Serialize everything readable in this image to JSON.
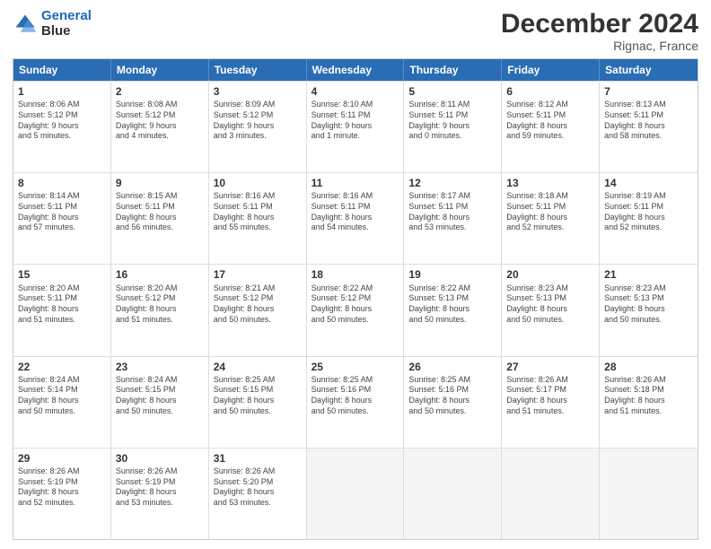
{
  "header": {
    "logo_line1": "General",
    "logo_line2": "Blue",
    "month_title": "December 2024",
    "location": "Rignac, France"
  },
  "days_of_week": [
    "Sunday",
    "Monday",
    "Tuesday",
    "Wednesday",
    "Thursday",
    "Friday",
    "Saturday"
  ],
  "weeks": [
    [
      {
        "day": "1",
        "lines": [
          "Sunrise: 8:06 AM",
          "Sunset: 5:12 PM",
          "Daylight: 9 hours",
          "and 5 minutes."
        ]
      },
      {
        "day": "2",
        "lines": [
          "Sunrise: 8:08 AM",
          "Sunset: 5:12 PM",
          "Daylight: 9 hours",
          "and 4 minutes."
        ]
      },
      {
        "day": "3",
        "lines": [
          "Sunrise: 8:09 AM",
          "Sunset: 5:12 PM",
          "Daylight: 9 hours",
          "and 3 minutes."
        ]
      },
      {
        "day": "4",
        "lines": [
          "Sunrise: 8:10 AM",
          "Sunset: 5:11 PM",
          "Daylight: 9 hours",
          "and 1 minute."
        ]
      },
      {
        "day": "5",
        "lines": [
          "Sunrise: 8:11 AM",
          "Sunset: 5:11 PM",
          "Daylight: 9 hours",
          "and 0 minutes."
        ]
      },
      {
        "day": "6",
        "lines": [
          "Sunrise: 8:12 AM",
          "Sunset: 5:11 PM",
          "Daylight: 8 hours",
          "and 59 minutes."
        ]
      },
      {
        "day": "7",
        "lines": [
          "Sunrise: 8:13 AM",
          "Sunset: 5:11 PM",
          "Daylight: 8 hours",
          "and 58 minutes."
        ]
      }
    ],
    [
      {
        "day": "8",
        "lines": [
          "Sunrise: 8:14 AM",
          "Sunset: 5:11 PM",
          "Daylight: 8 hours",
          "and 57 minutes."
        ]
      },
      {
        "day": "9",
        "lines": [
          "Sunrise: 8:15 AM",
          "Sunset: 5:11 PM",
          "Daylight: 8 hours",
          "and 56 minutes."
        ]
      },
      {
        "day": "10",
        "lines": [
          "Sunrise: 8:16 AM",
          "Sunset: 5:11 PM",
          "Daylight: 8 hours",
          "and 55 minutes."
        ]
      },
      {
        "day": "11",
        "lines": [
          "Sunrise: 8:16 AM",
          "Sunset: 5:11 PM",
          "Daylight: 8 hours",
          "and 54 minutes."
        ]
      },
      {
        "day": "12",
        "lines": [
          "Sunrise: 8:17 AM",
          "Sunset: 5:11 PM",
          "Daylight: 8 hours",
          "and 53 minutes."
        ]
      },
      {
        "day": "13",
        "lines": [
          "Sunrise: 8:18 AM",
          "Sunset: 5:11 PM",
          "Daylight: 8 hours",
          "and 52 minutes."
        ]
      },
      {
        "day": "14",
        "lines": [
          "Sunrise: 8:19 AM",
          "Sunset: 5:11 PM",
          "Daylight: 8 hours",
          "and 52 minutes."
        ]
      }
    ],
    [
      {
        "day": "15",
        "lines": [
          "Sunrise: 8:20 AM",
          "Sunset: 5:11 PM",
          "Daylight: 8 hours",
          "and 51 minutes."
        ]
      },
      {
        "day": "16",
        "lines": [
          "Sunrise: 8:20 AM",
          "Sunset: 5:12 PM",
          "Daylight: 8 hours",
          "and 51 minutes."
        ]
      },
      {
        "day": "17",
        "lines": [
          "Sunrise: 8:21 AM",
          "Sunset: 5:12 PM",
          "Daylight: 8 hours",
          "and 50 minutes."
        ]
      },
      {
        "day": "18",
        "lines": [
          "Sunrise: 8:22 AM",
          "Sunset: 5:12 PM",
          "Daylight: 8 hours",
          "and 50 minutes."
        ]
      },
      {
        "day": "19",
        "lines": [
          "Sunrise: 8:22 AM",
          "Sunset: 5:13 PM",
          "Daylight: 8 hours",
          "and 50 minutes."
        ]
      },
      {
        "day": "20",
        "lines": [
          "Sunrise: 8:23 AM",
          "Sunset: 5:13 PM",
          "Daylight: 8 hours",
          "and 50 minutes."
        ]
      },
      {
        "day": "21",
        "lines": [
          "Sunrise: 8:23 AM",
          "Sunset: 5:13 PM",
          "Daylight: 8 hours",
          "and 50 minutes."
        ]
      }
    ],
    [
      {
        "day": "22",
        "lines": [
          "Sunrise: 8:24 AM",
          "Sunset: 5:14 PM",
          "Daylight: 8 hours",
          "and 50 minutes."
        ]
      },
      {
        "day": "23",
        "lines": [
          "Sunrise: 8:24 AM",
          "Sunset: 5:15 PM",
          "Daylight: 8 hours",
          "and 50 minutes."
        ]
      },
      {
        "day": "24",
        "lines": [
          "Sunrise: 8:25 AM",
          "Sunset: 5:15 PM",
          "Daylight: 8 hours",
          "and 50 minutes."
        ]
      },
      {
        "day": "25",
        "lines": [
          "Sunrise: 8:25 AM",
          "Sunset: 5:16 PM",
          "Daylight: 8 hours",
          "and 50 minutes."
        ]
      },
      {
        "day": "26",
        "lines": [
          "Sunrise: 8:25 AM",
          "Sunset: 5:16 PM",
          "Daylight: 8 hours",
          "and 50 minutes."
        ]
      },
      {
        "day": "27",
        "lines": [
          "Sunrise: 8:26 AM",
          "Sunset: 5:17 PM",
          "Daylight: 8 hours",
          "and 51 minutes."
        ]
      },
      {
        "day": "28",
        "lines": [
          "Sunrise: 8:26 AM",
          "Sunset: 5:18 PM",
          "Daylight: 8 hours",
          "and 51 minutes."
        ]
      }
    ],
    [
      {
        "day": "29",
        "lines": [
          "Sunrise: 8:26 AM",
          "Sunset: 5:19 PM",
          "Daylight: 8 hours",
          "and 52 minutes."
        ]
      },
      {
        "day": "30",
        "lines": [
          "Sunrise: 8:26 AM",
          "Sunset: 5:19 PM",
          "Daylight: 8 hours",
          "and 53 minutes."
        ]
      },
      {
        "day": "31",
        "lines": [
          "Sunrise: 8:26 AM",
          "Sunset: 5:20 PM",
          "Daylight: 8 hours",
          "and 53 minutes."
        ]
      },
      {
        "day": "",
        "lines": []
      },
      {
        "day": "",
        "lines": []
      },
      {
        "day": "",
        "lines": []
      },
      {
        "day": "",
        "lines": []
      }
    ]
  ]
}
